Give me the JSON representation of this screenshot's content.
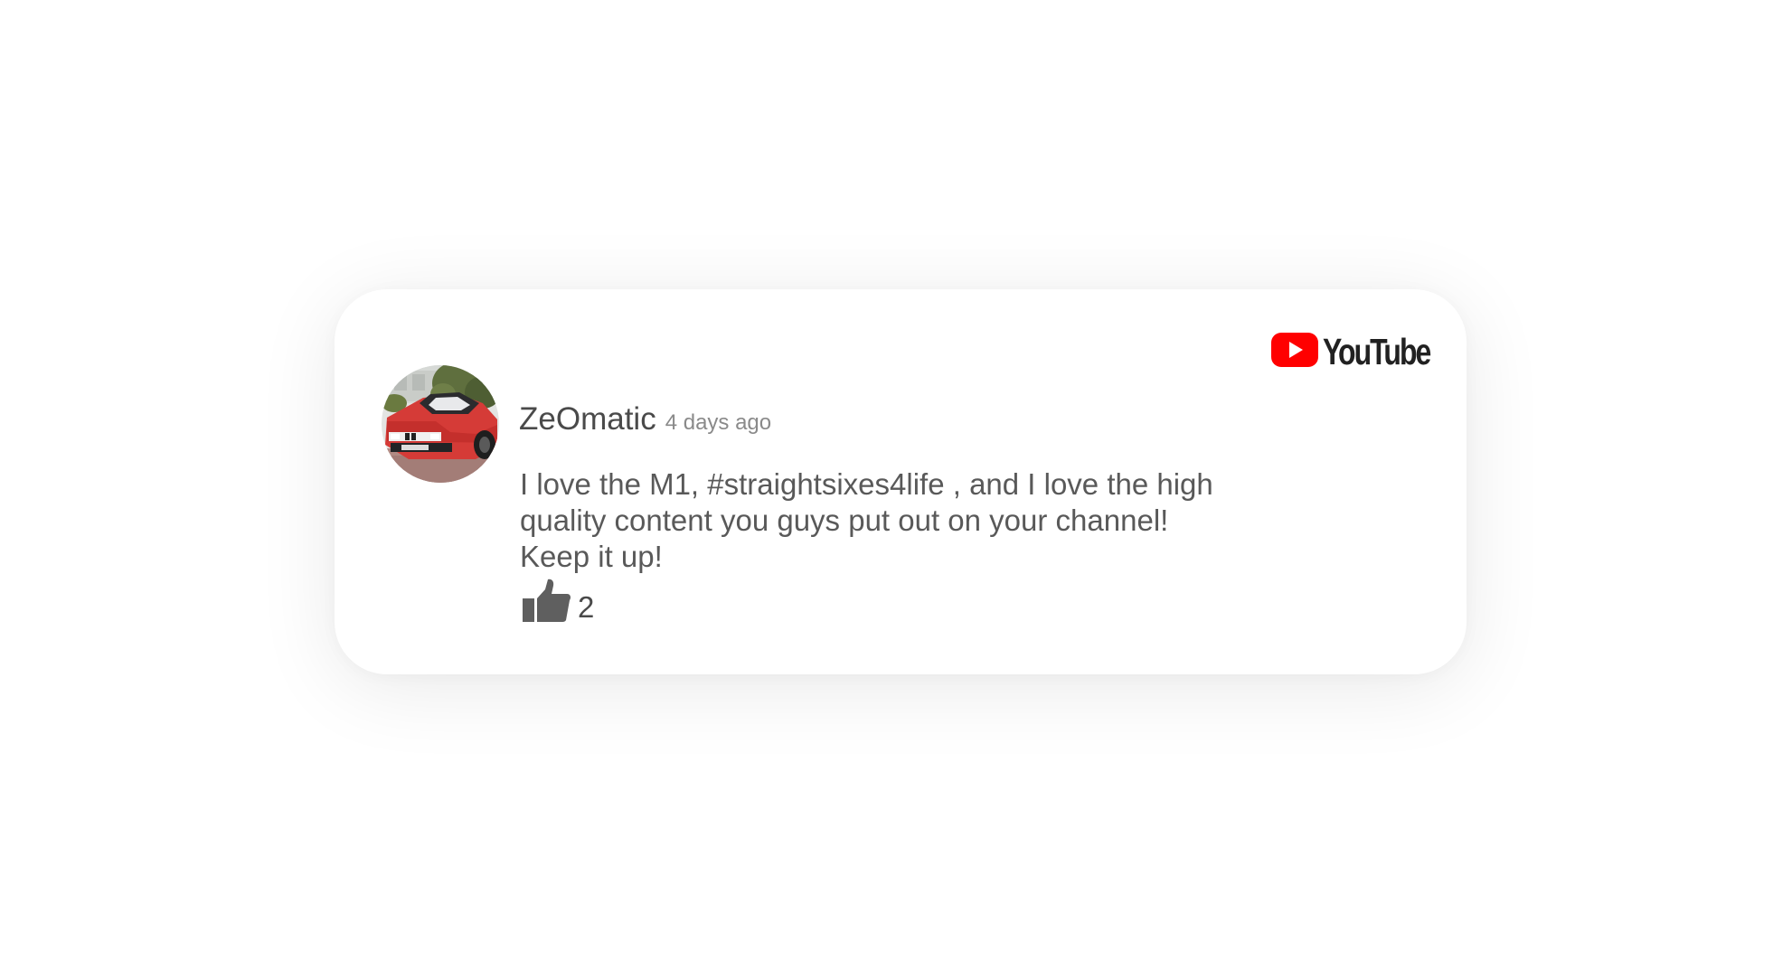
{
  "brand": {
    "name": "YouTube",
    "icon": "youtube-play-icon",
    "icon_color": "#FF0000",
    "wordmark_color": "#212121"
  },
  "comment": {
    "author": "ZeOmatic",
    "timestamp": "4 days ago",
    "avatar": "avatar showing a red BMW M1 car",
    "text_lines": [
      "I love the M1, #straightsixes4life , and I love the high",
      "quality content you guys put out on your channel!",
      "Keep it up!"
    ],
    "like_icon": "thumbs-up-icon",
    "like_count": "2"
  },
  "colors": {
    "text": "#595959",
    "author": "#4a4a4a",
    "muted": "#8a8a8a",
    "card_background": "#ffffff"
  }
}
